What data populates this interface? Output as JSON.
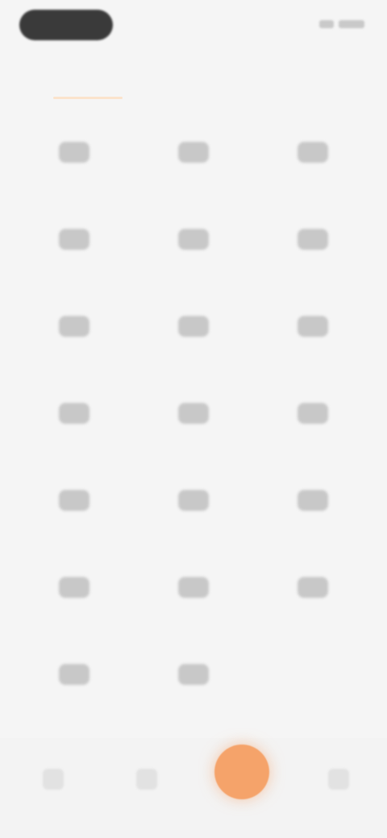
{
  "status_bar": {
    "pill_text": "",
    "right_items": [
      "signal-icon",
      "battery-icon"
    ]
  },
  "header": {
    "title": ""
  },
  "grid": {
    "items": [
      {
        "label": "",
        "icon": "feature-icon"
      },
      {
        "label": "",
        "icon": "feature-icon"
      },
      {
        "label": "",
        "icon": "feature-icon"
      },
      {
        "label": "",
        "icon": "feature-icon"
      },
      {
        "label": "",
        "icon": "feature-icon"
      },
      {
        "label": "",
        "icon": "feature-icon"
      },
      {
        "label": "",
        "icon": "feature-icon"
      },
      {
        "label": "",
        "icon": "feature-icon"
      },
      {
        "label": "",
        "icon": "feature-icon"
      },
      {
        "label": "",
        "icon": "feature-icon"
      },
      {
        "label": "",
        "icon": "feature-icon"
      },
      {
        "label": "",
        "icon": "feature-icon"
      },
      {
        "label": "",
        "icon": "feature-icon"
      },
      {
        "label": "",
        "icon": "feature-icon"
      },
      {
        "label": "",
        "icon": "feature-icon"
      },
      {
        "label": "",
        "icon": "feature-icon"
      },
      {
        "label": "",
        "icon": "feature-icon"
      },
      {
        "label": "",
        "icon": "feature-icon"
      },
      {
        "label": "",
        "icon": "feature-icon"
      },
      {
        "label": "",
        "icon": "feature-icon"
      }
    ]
  },
  "tabbar": {
    "tabs": [
      {
        "label": "",
        "icon": "home-icon"
      },
      {
        "label": "",
        "icon": "apps-icon"
      },
      {
        "label": "",
        "icon": "add-icon"
      },
      {
        "label": "",
        "icon": "profile-icon"
      }
    ]
  },
  "colors": {
    "accent": "#f5a36a",
    "background": "#f5f5f5"
  }
}
